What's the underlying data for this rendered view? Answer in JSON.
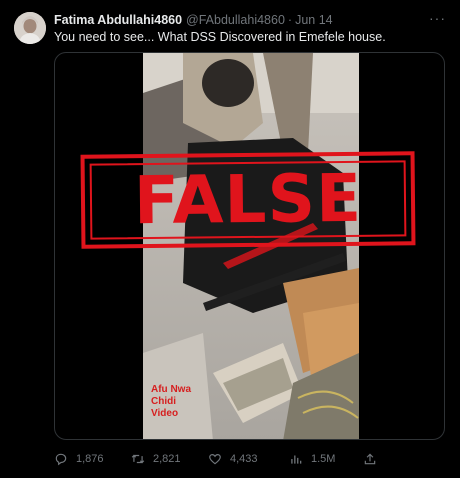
{
  "tweet": {
    "author_name": "Fatima Abdullahi4860",
    "handle": "@FAbdullahi4860",
    "separator": "·",
    "date": "Jun 14",
    "text": "You need to see... What DSS Discovered in Emefele house.",
    "more_icon": "more-horizontal-icon"
  },
  "media": {
    "stamp_text": "FALSE",
    "watermark_lines": [
      "Afu Nwa",
      "Chidi",
      "Video"
    ]
  },
  "actions": {
    "replies": "1,876",
    "retweets": "2,821",
    "likes": "4,433",
    "views": "1.5M"
  },
  "colors": {
    "background": "#000000",
    "text_primary": "#e7e9ea",
    "text_secondary": "#71767b",
    "stamp_red": "#e0141c"
  }
}
